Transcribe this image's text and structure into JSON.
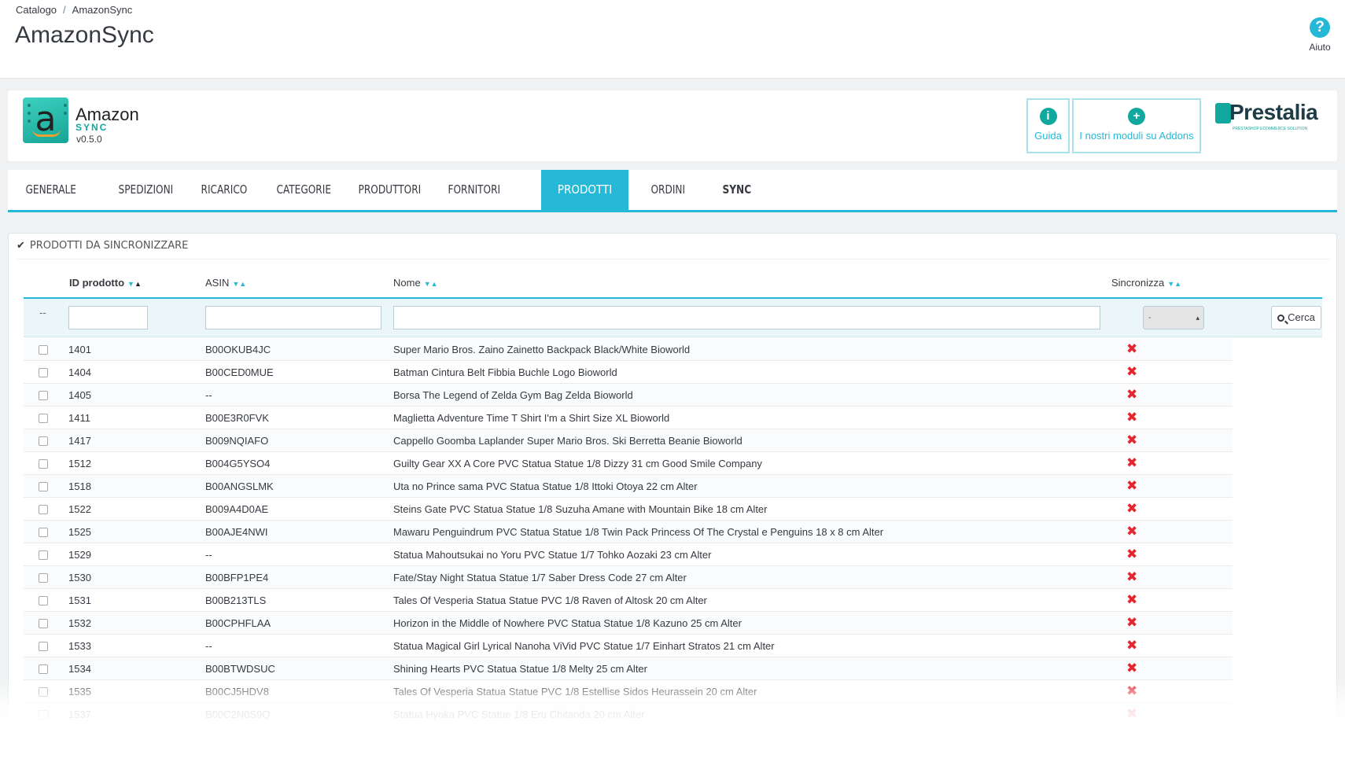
{
  "breadcrumb": {
    "parent": "Catalogo",
    "separator": "/",
    "current": "AmazonSync"
  },
  "page_title": "AmazonSync",
  "help": {
    "label": "Aiuto"
  },
  "module": {
    "logo_letter": "a",
    "name": "Amazon",
    "sub": "SYNC",
    "version": "v0.5.0",
    "buttons": {
      "guide": "Guida",
      "addons": "I nostri moduli su Addons"
    },
    "partner": {
      "name": "Prestalia",
      "tagline": "PRESTASHOP ECOMMERCE SOLUTION"
    }
  },
  "tabs": [
    "GENERALE",
    "SPEDIZIONI",
    "RICARICO",
    "CATEGORIE",
    "PRODUTTORI",
    "FORNITORI",
    "PRODOTTI",
    "ORDINI",
    "SYNC"
  ],
  "active_tab": "PRODOTTI",
  "panel": {
    "heading": "PRODOTTI DA SINCRONIZZARE",
    "columns": {
      "id": "ID prodotto",
      "asin": "ASIN",
      "name": "Nome",
      "sync": "Sincronizza"
    },
    "filter": {
      "bulk": "--",
      "select_value": "-",
      "search": "Cerca"
    },
    "rows": [
      {
        "id": "1401",
        "asin": "B00OKUB4JC",
        "name": "Super Mario Bros. Zaino Zainetto Backpack Black/White Bioworld"
      },
      {
        "id": "1404",
        "asin": "B00CED0MUE",
        "name": "Batman Cintura Belt Fibbia Buchle Logo Bioworld"
      },
      {
        "id": "1405",
        "asin": "--",
        "name": "Borsa The Legend of Zelda Gym Bag Zelda Bioworld"
      },
      {
        "id": "1411",
        "asin": "B00E3R0FVK",
        "name": "Maglietta Adventure Time T Shirt I'm a Shirt Size XL Bioworld"
      },
      {
        "id": "1417",
        "asin": "B009NQIAFO",
        "name": "Cappello Goomba Laplander Super Mario Bros. Ski Berretta Beanie Bioworld"
      },
      {
        "id": "1512",
        "asin": "B004G5YSO4",
        "name": "Guilty Gear XX A Core PVC Statua Statue 1/8 Dizzy 31 cm Good Smile Company"
      },
      {
        "id": "1518",
        "asin": "B00ANGSLMK",
        "name": "Uta no Prince sama PVC Statua Statue 1/8 Ittoki Otoya 22 cm Alter"
      },
      {
        "id": "1522",
        "asin": "B009A4D0AE",
        "name": "Steins Gate PVC Statua Statue 1/8 Suzuha Amane with Mountain Bike 18 cm Alter"
      },
      {
        "id": "1525",
        "asin": "B00AJE4NWI",
        "name": "Mawaru Penguindrum PVC Statua Statue 1/8 Twin Pack Princess Of The Crystal e Penguins 18 x 8 cm Alter"
      },
      {
        "id": "1529",
        "asin": "--",
        "name": "Statua Mahoutsukai no Yoru PVC Statue 1/7 Tohko Aozaki 23 cm Alter"
      },
      {
        "id": "1530",
        "asin": "B00BFP1PE4",
        "name": "Fate/Stay Night Statua Statue 1/7 Saber Dress Code 27 cm Alter"
      },
      {
        "id": "1531",
        "asin": "B00B213TLS",
        "name": "Tales Of Vesperia Statua Statue PVC 1/8 Raven of Altosk 20 cm Alter"
      },
      {
        "id": "1532",
        "asin": "B00CPHFLAA",
        "name": "Horizon in the Middle of Nowhere PVC Statua Statue 1/8 Kazuno 25 cm Alter"
      },
      {
        "id": "1533",
        "asin": "--",
        "name": "Statua Magical Girl Lyrical Nanoha ViVid PVC Statue 1/7 Einhart Stratos 21 cm Alter"
      },
      {
        "id": "1534",
        "asin": "B00BTWDSUC",
        "name": "Shining Hearts PVC Statua Statue 1/8 Melty 25 cm Alter"
      },
      {
        "id": "1535",
        "asin": "B00CJ5HDV8",
        "name": "Tales Of Vesperia Statua Statue PVC 1/8 Estellise Sidos Heurassein 20 cm Alter"
      },
      {
        "id": "1537",
        "asin": "B00C2N0S9Q",
        "name": "Statua Hyoka PVC Statue 1/8 Eru Chitanda 20 cm Alter"
      }
    ]
  },
  "colors": {
    "accent": "#25b9d7",
    "teal": "#13a89e",
    "sync_off": "#e3262f"
  }
}
